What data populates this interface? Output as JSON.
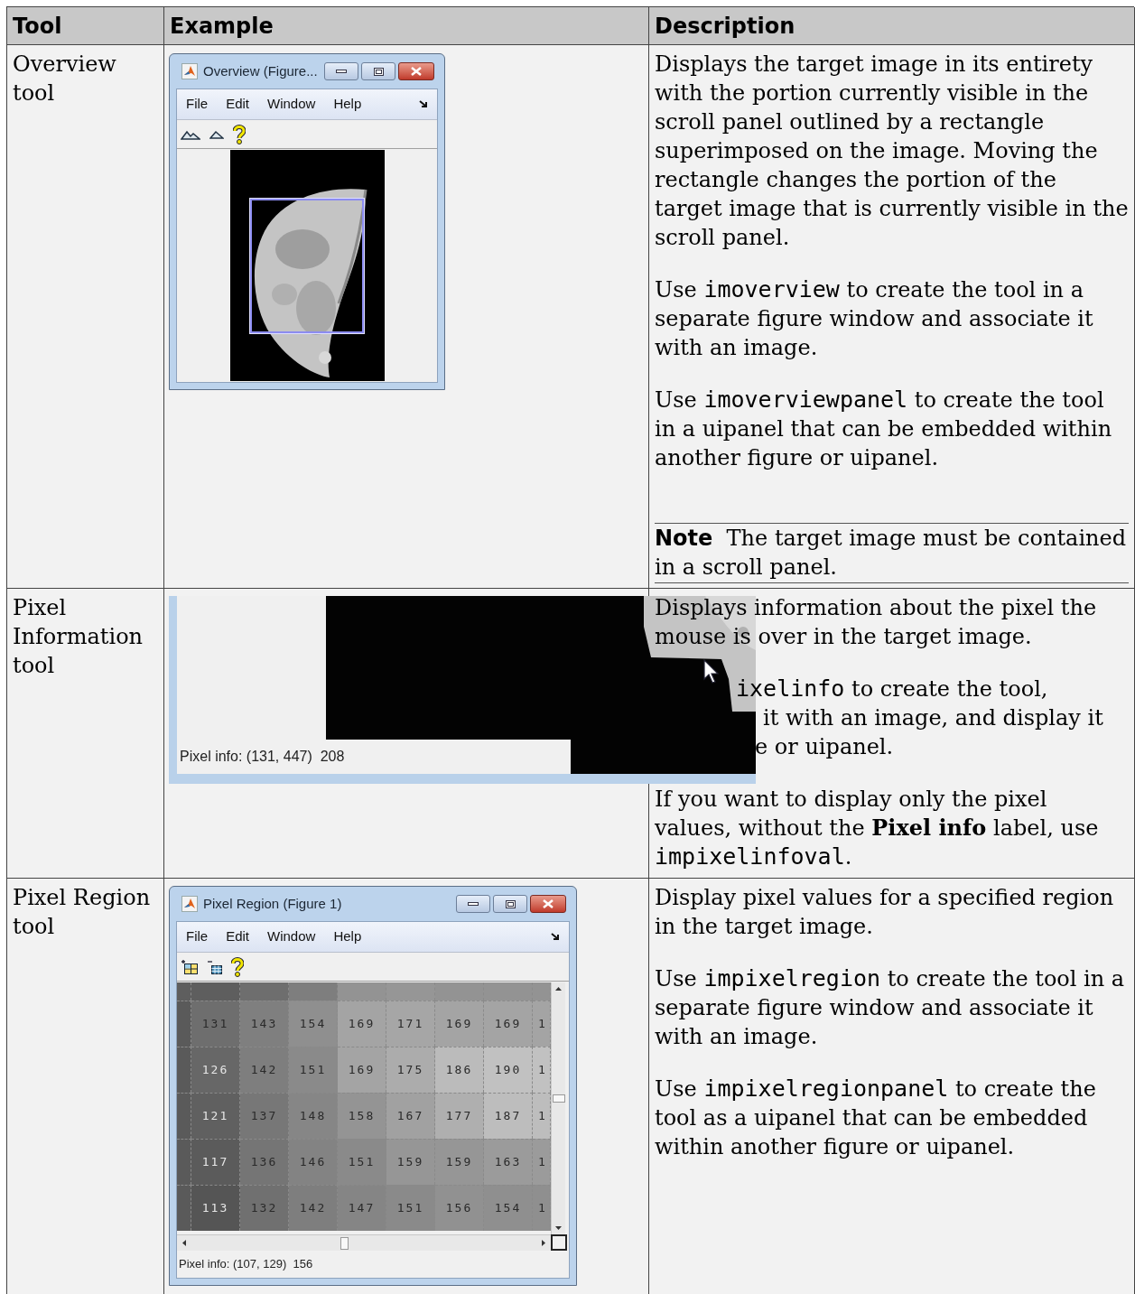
{
  "columns": [
    "Tool",
    "Example",
    "Description"
  ],
  "rows": [
    {
      "tool": "Overview tool",
      "example": {
        "kind": "overview",
        "title": "Overview (Figure...",
        "menu": [
          "File",
          "Edit",
          "Window",
          "Help"
        ]
      },
      "description": [
        {
          "kind": "para",
          "segments": [
            {
              "text": "Displays the target image in its entirety with the portion currently visible in the scroll panel outlined by a rectangle superimposed on the image. Moving the rectangle changes the portion of the target image that is currently visible in the scroll panel.",
              "code": false
            }
          ]
        },
        {
          "kind": "para",
          "segments": [
            {
              "text": "Use ",
              "code": false
            },
            {
              "text": "imoverview",
              "code": true
            },
            {
              "text": " to create the tool in a separate figure window and associate it with an image.",
              "code": false
            }
          ]
        },
        {
          "kind": "para",
          "segments": [
            {
              "text": "Use ",
              "code": false
            },
            {
              "text": "imoverviewpanel",
              "code": true
            },
            {
              "text": " to create the tool in a uipanel that can be embedded within another figure or uipanel.",
              "code": false
            }
          ]
        },
        {
          "kind": "note",
          "label": "Note",
          "text": "The target image must be contained in a scroll panel."
        }
      ]
    },
    {
      "tool": "Pixel Information tool",
      "example": {
        "kind": "pixelinfo",
        "status": "Pixel info: (131, 447)  208"
      },
      "description": [
        {
          "kind": "para",
          "segments": [
            {
              "text": "Displays information about the pixel the mouse is over in the target image.",
              "code": false
            }
          ]
        },
        {
          "kind": "lines",
          "lines": [
            [
              {
                "text": "ixelinfo",
                "code": true
              },
              {
                "text": " to create the tool,",
                "code": false
              }
            ],
            [
              {
                "text": "it with an image, and display it",
                "code": false
              }
            ],
            [
              {
                "text": "e or uipanel.",
                "code": false
              }
            ]
          ]
        },
        {
          "kind": "para",
          "segments": [
            {
              "text": "If you want to display only the pixel values, without the **Pixel info** label, use ",
              "code": false
            },
            {
              "text": "impixelinfoval",
              "code": true
            },
            {
              "text": ".",
              "code": false
            }
          ]
        }
      ]
    },
    {
      "tool": "Pixel Region tool",
      "example": {
        "kind": "pixelregion",
        "title": "Pixel Region (Figure 1)",
        "menu": [
          "File",
          "Edit",
          "Window",
          "Help"
        ],
        "status": "Pixel info: (107, 129)  156",
        "grid": [
          [
            "131",
            "143",
            "154",
            "169",
            "171",
            "169",
            "169",
            "1"
          ],
          [
            "126",
            "142",
            "151",
            "169",
            "175",
            "186",
            "190",
            "1"
          ],
          [
            "121",
            "137",
            "148",
            "158",
            "167",
            "177",
            "187",
            "1"
          ],
          [
            "117",
            "136",
            "146",
            "151",
            "159",
            "159",
            "163",
            "1"
          ],
          [
            "113",
            "132",
            "142",
            "147",
            "151",
            "156",
            "154",
            "1"
          ]
        ]
      },
      "description": [
        {
          "kind": "para",
          "segments": [
            {
              "text": "Display pixel values for a specified region in the target image.",
              "code": false
            }
          ]
        },
        {
          "kind": "para",
          "segments": [
            {
              "text": "Use ",
              "code": false
            },
            {
              "text": "impixelregion",
              "code": true
            },
            {
              "text": " to create the tool in a separate figure window and associate it with an image.",
              "code": false
            }
          ]
        },
        {
          "kind": "para",
          "segments": [
            {
              "text": "Use ",
              "code": false
            },
            {
              "text": "impixelregionpanel",
              "code": true
            },
            {
              "text": " to create the tool as a uipanel that can be embedded within another figure or uipanel.",
              "code": false
            }
          ]
        }
      ]
    }
  ]
}
